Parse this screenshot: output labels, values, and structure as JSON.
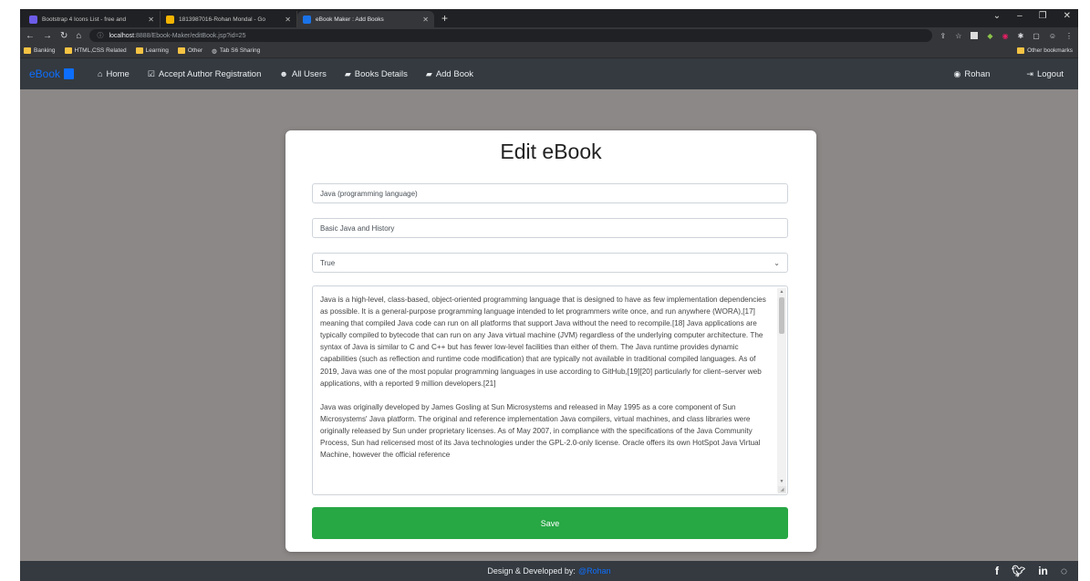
{
  "browser": {
    "tabs": [
      {
        "title": "Bootstrap 4 Icons List - free and",
        "icon_color": "#6c5ce7"
      },
      {
        "title": "1813987016-Rohan Mondal - Go",
        "icon_color": "#f4b400"
      },
      {
        "title": "eBook Maker : Add Books",
        "icon_color": "#1a73e8"
      }
    ],
    "url_host": "localhost",
    "url_rest": ":8888/Ebook-Maker/editBook.jsp?id=25",
    "bookmarks": [
      "Banking",
      "HTML,CSS Related",
      "Learning",
      "Other",
      "Tab S6 Sharing"
    ],
    "other_bookmarks": "Other bookmarks"
  },
  "navbar": {
    "brand": "eBook",
    "items": [
      "Home",
      "Accept Author Registration",
      "All Users",
      "Books Details",
      "Add Book"
    ],
    "user": "Rohan",
    "logout": "Logout"
  },
  "form": {
    "title": "Edit eBook",
    "book_name": "Java (programming language)",
    "book_subtitle": "Basic Java and History",
    "status_selected": "True",
    "description_p1": "Java is a high-level, class-based, object-oriented programming language that is designed to have as few implementation dependencies as possible. It is a general-purpose programming language intended to let programmers write once, and run anywhere (WORA),[17] meaning that compiled Java code can run on all platforms that support Java without the need to recompile.[18] Java applications are typically compiled to bytecode that can run on any Java virtual machine (JVM) regardless of the underlying computer architecture. The syntax of Java is similar to C and C++ but has fewer low-level facilities than either of them. The Java runtime provides dynamic capabilities (such as reflection and runtime code modification) that are typically not available in traditional compiled languages. As of 2019, Java was one of the most popular programming languages in use according to GitHub,[19][20] particularly for client–server web applications, with a reported 9 million developers.[21]",
    "description_p2": "Java was originally developed by James Gosling at Sun Microsystems and released in May 1995 as a core component of Sun Microsystems' Java platform. The original and reference implementation Java compilers, virtual machines, and class libraries were originally released by Sun under proprietary licenses. As of May 2007, in compliance with the specifications of the Java Community Process, Sun had relicensed most of its Java technologies under the GPL-2.0-only license. Oracle offers its own HotSpot Java Virtual Machine, however the official reference",
    "save_label": "Save"
  },
  "footer": {
    "text": "Design & Developed by:",
    "author": "@Rohan"
  },
  "colors": {
    "navbar_bg": "#343a40",
    "brand": "#0d6efd",
    "save_btn": "#28a745",
    "page_bg": "#8c8887"
  }
}
